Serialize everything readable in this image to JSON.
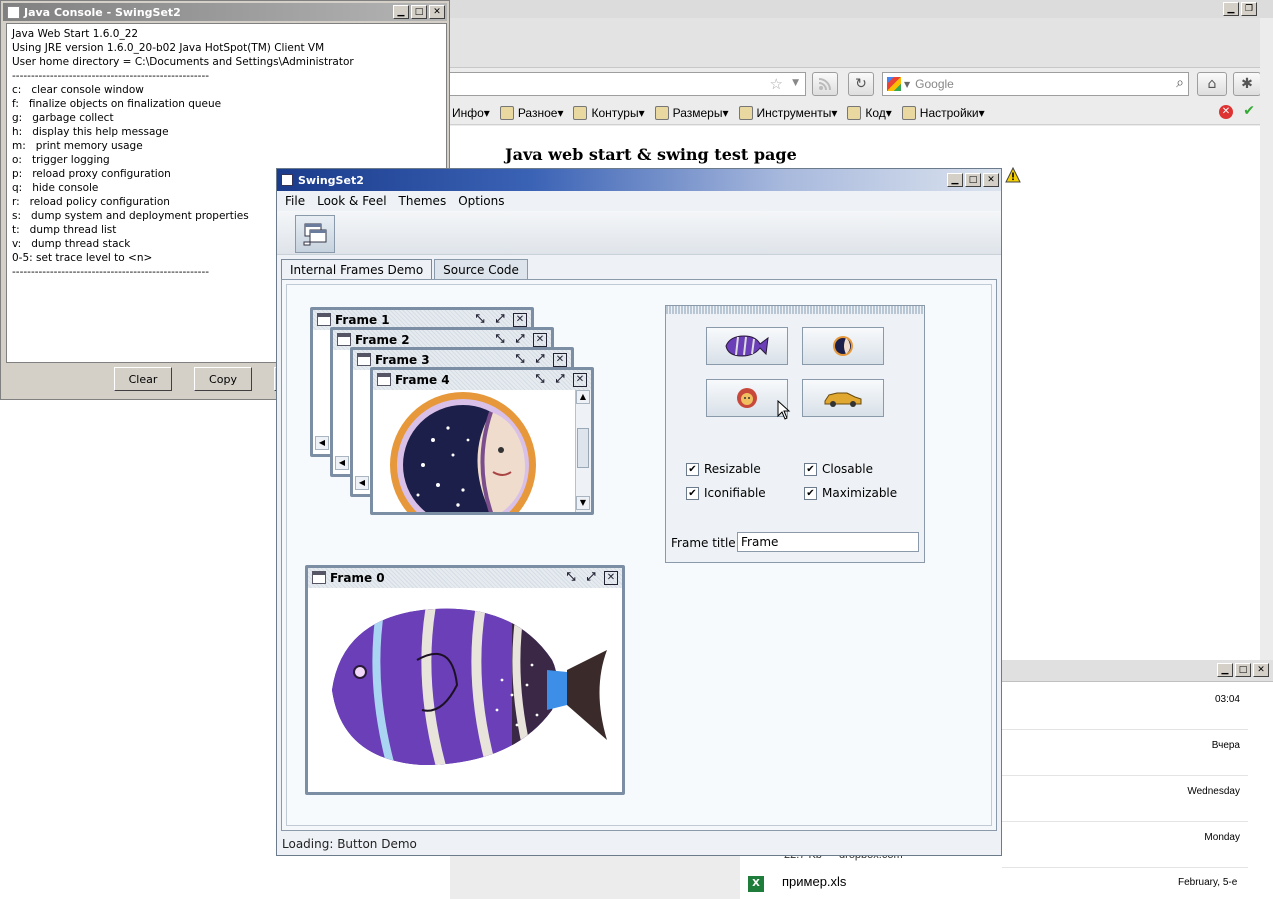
{
  "console": {
    "title": "Java Console - SwingSet2",
    "lines": [
      "Java Web Start 1.6.0_22",
      "Using JRE version 1.6.0_20-b02 Java HotSpot(TM) Client VM",
      "User home directory = C:\\Documents and Settings\\Administrator",
      "----------------------------------------------------",
      "c:   clear console window",
      "f:   finalize objects on finalization queue",
      "g:   garbage collect",
      "h:   display this help message",
      "m:   print memory usage",
      "o:   trigger logging",
      "p:   reload proxy configuration",
      "q:   hide console",
      "r:   reload policy configuration",
      "s:   dump system and deployment properties",
      "t:   dump thread list",
      "v:   dump thread stack",
      "0-5: set trace level to <n>",
      "----------------------------------------------------"
    ],
    "clear_label": "Clear",
    "copy_label": "Copy"
  },
  "browser": {
    "search_placeholder": "Google",
    "bookmarks": [
      "Инфо▾",
      "Разное▾",
      "Контуры▾",
      "Размеры▾",
      "Инструменты▾",
      "Код▾",
      "Настройки▾"
    ],
    "page_heading": "Java web start & swing test page"
  },
  "lower_window": {
    "dates": [
      "03:04",
      "Вчера",
      "Wednesday",
      "Monday",
      "February, 5-e"
    ],
    "file_size": "22.7 Kb — dropbox.com",
    "file_name": "пример.xls"
  },
  "swing": {
    "title": "SwingSet2",
    "menu": [
      "File",
      "Look & Feel",
      "Themes",
      "Options"
    ],
    "tabs": [
      "Internal Frames Demo",
      "Source Code"
    ],
    "frames": [
      "Frame 0",
      "Frame 1",
      "Frame 2",
      "Frame 3",
      "Frame 4"
    ],
    "checkboxes": {
      "resizable": "Resizable",
      "closable": "Closable",
      "iconifiable": "Iconifiable",
      "maximizable": "Maximizable"
    },
    "checks_state": {
      "resizable": true,
      "closable": true,
      "iconifiable": true,
      "maximizable": true
    },
    "frame_title_label": "Frame title:",
    "frame_title_value": "Frame",
    "status": "Loading: Button Demo"
  }
}
